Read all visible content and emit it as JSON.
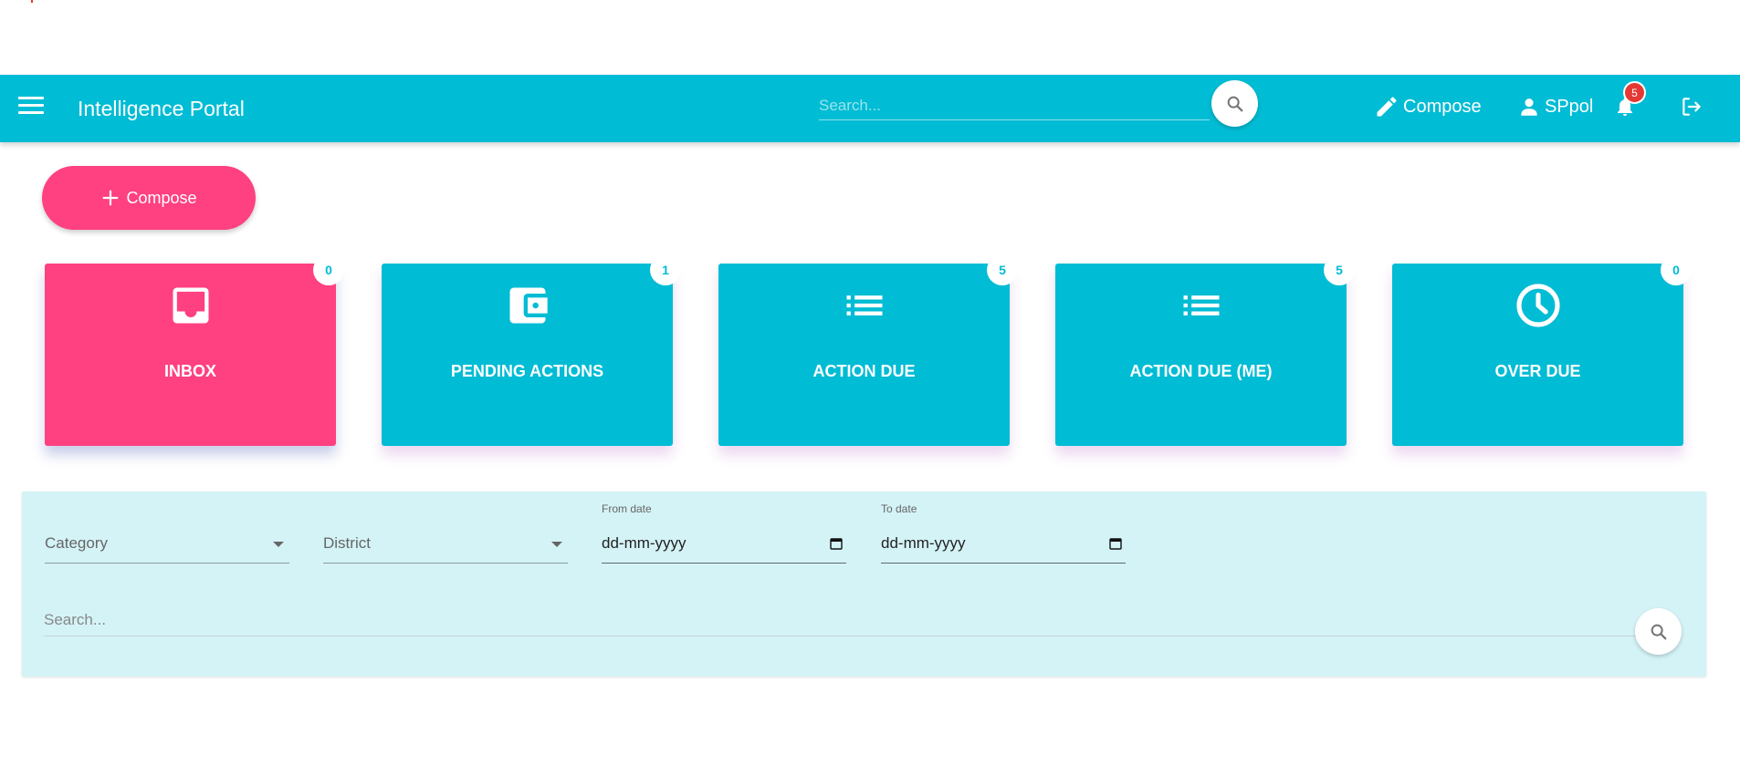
{
  "header": {
    "title": "Intelligence Portal",
    "search_placeholder": "Search...",
    "compose_label": "Compose",
    "user_label": "SPpol",
    "notification_count": "5",
    "icons": [
      "menu-icon",
      "search-icon",
      "pencil-icon",
      "person-icon",
      "bell-icon",
      "logout-icon"
    ]
  },
  "compose_button": {
    "label": "Compose",
    "icon": "plus-icon"
  },
  "tiles": [
    {
      "label": "INBOX",
      "count": "0",
      "icon": "inbox-icon",
      "color": "#ff4081"
    },
    {
      "label": "PENDING ACTIONS",
      "count": "1",
      "icon": "wallet-icon",
      "color": "#00bcd4"
    },
    {
      "label": "ACTION DUE",
      "count": "5",
      "icon": "list-icon",
      "color": "#00bcd4"
    },
    {
      "label": "ACTION DUE (ME)",
      "count": "5",
      "icon": "list-icon",
      "color": "#00bcd4"
    },
    {
      "label": "OVER DUE",
      "count": "0",
      "icon": "clock-icon",
      "color": "#00bcd4"
    }
  ],
  "filters": {
    "category_label": "Category",
    "district_label": "District",
    "from_date_label": "From date",
    "from_date_value": "dd-mm-yyyy",
    "to_date_label": "To date",
    "to_date_value": "dd-mm-yyyy",
    "search_placeholder": "Search..."
  },
  "colors": {
    "primary": "#00bcd4",
    "accent": "#ff4081",
    "badge": "#e53935",
    "panel": "#d4f3f6"
  }
}
